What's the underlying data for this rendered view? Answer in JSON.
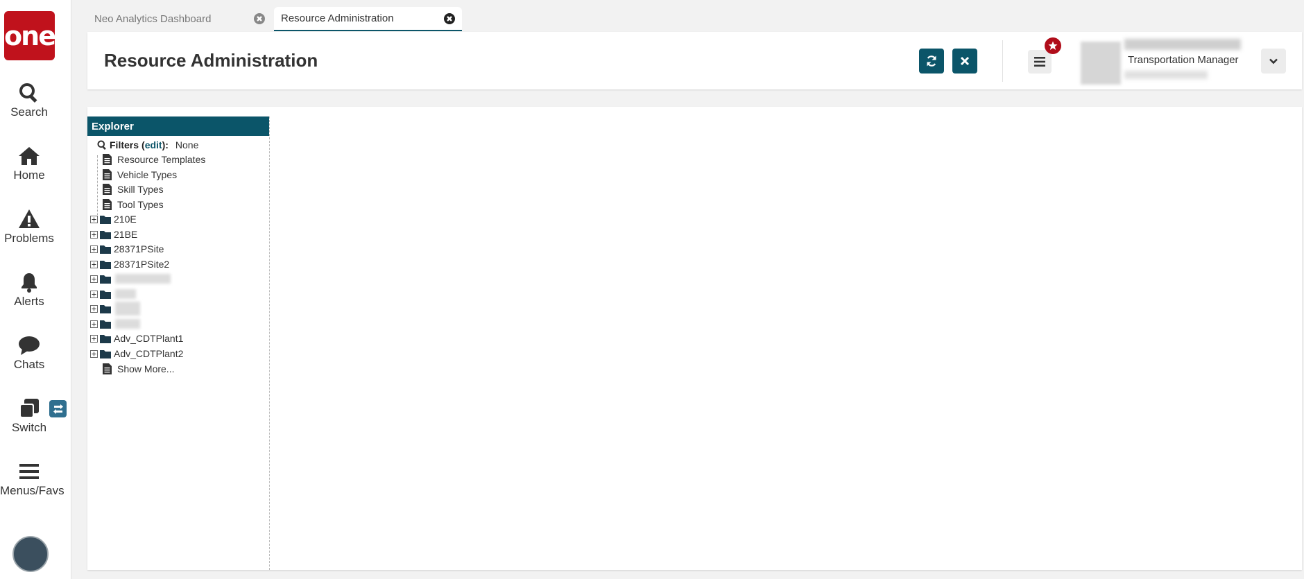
{
  "nav": {
    "logo_text": "one",
    "items": [
      {
        "label": "Search",
        "icon": "search-icon"
      },
      {
        "label": "Home",
        "icon": "home-icon"
      },
      {
        "label": "Problems",
        "icon": "warning-icon"
      },
      {
        "label": "Alerts",
        "icon": "bell-icon"
      },
      {
        "label": "Chats",
        "icon": "chat-icon"
      },
      {
        "label": "Switch",
        "icon": "switch-icon"
      },
      {
        "label": "Menus/Favs",
        "icon": "hamburger-icon"
      }
    ]
  },
  "tabs": [
    {
      "label": "Neo Analytics Dashboard",
      "active": false
    },
    {
      "label": "Resource Administration",
      "active": true
    }
  ],
  "header": {
    "title": "Resource Administration",
    "user_role": "Transportation Manager"
  },
  "explorer": {
    "title": "Explorer",
    "filters_label": "Filters",
    "filters_open_paren": "(",
    "filters_edit": "edit",
    "filters_close": "):",
    "filters_value": "None",
    "items": [
      {
        "label": "Resource Templates",
        "type": "document"
      },
      {
        "label": "Vehicle Types",
        "type": "document"
      },
      {
        "label": "Skill Types",
        "type": "document"
      },
      {
        "label": "Tool Types",
        "type": "document"
      },
      {
        "label": "210E",
        "type": "folder"
      },
      {
        "label": "21BE",
        "type": "folder"
      },
      {
        "label": "28371PSite",
        "type": "folder"
      },
      {
        "label": "28371PSite2",
        "type": "folder"
      },
      {
        "label": "",
        "type": "folder"
      },
      {
        "label": "",
        "type": "folder"
      },
      {
        "label": "",
        "type": "folder"
      },
      {
        "label": "",
        "type": "folder"
      },
      {
        "label": "Adv_CDTPlant1",
        "type": "folder"
      },
      {
        "label": "Adv_CDTPlant2",
        "type": "folder"
      },
      {
        "label": "Show More...",
        "type": "document"
      }
    ]
  },
  "colors": {
    "brand_red": "#c0121c",
    "accent_teal": "#0b5569",
    "badge_red": "#b00d1a"
  }
}
